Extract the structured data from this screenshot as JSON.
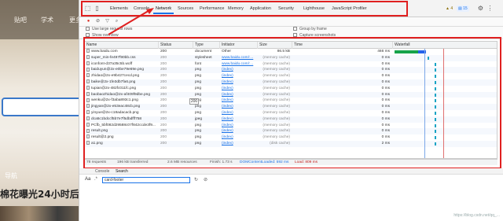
{
  "background_page": {
    "nav_items": [
      "贴吧",
      "学术",
      "更多"
    ],
    "guide_label": "导航",
    "headline": "棉花曝光24小时后"
  },
  "devtools": {
    "tabs": [
      "Elements",
      "Console",
      "Network",
      "Sources",
      "Performance",
      "Memory",
      "Application",
      "Security",
      "Lighthouse",
      "JavaScript Profiler"
    ],
    "active_tab": "Network",
    "warnings_count": "4",
    "messages_count": "15",
    "options": {
      "use_large_rows": "Use large request rows",
      "show_overview": "Show overview",
      "group_by_frame": "Group by frame",
      "capture_screenshots": "Capture screenshots"
    },
    "columns": [
      "Name",
      "Status",
      "Type",
      "Initiator",
      "Size",
      "Time",
      "Waterfall"
    ],
    "rows": [
      {
        "name": "www.baidu.com",
        "status": "200",
        "type": "document",
        "initiator": "Other",
        "size": "86.5 kB",
        "time": "466 ms",
        "wf": 0
      },
      {
        "name": "super_min-fe497f90bb.css",
        "status": "200",
        "type": "stylesheet",
        "initiator": "www.baidu.com/:...",
        "size": "(memory cache)",
        "time": "0 ms",
        "wf": 1
      },
      {
        "name": "iconfont-d37a35c5b.woff",
        "status": "200",
        "type": "font",
        "initiator": "www.baidu.com/:...",
        "size": "(memory cache)",
        "time": "0 ms",
        "wf": 2
      },
      {
        "name": "baiduyun@2x-e0be79e69e.png",
        "status": "200",
        "type": "png",
        "initiator": "(index)",
        "size": "(memory cache)",
        "time": "0 ms",
        "wf": 2
      },
      {
        "name": "zhidao@2x-e9b427cecd.png",
        "status": "200",
        "type": "png",
        "initiator": "(index)",
        "size": "(memory cache)",
        "time": "0 ms",
        "wf": 2
      },
      {
        "name": "baike@2x-1fe3db7fa6.png",
        "status": "200",
        "type": "png",
        "initiator": "(index)",
        "size": "(memory cache)",
        "time": "0 ms",
        "wf": 2
      },
      {
        "name": "tupian@2x-482fc011fc.png",
        "status": "200",
        "type": "png",
        "initiator": "(index)",
        "size": "(memory cache)",
        "time": "0 ms",
        "wf": 2
      },
      {
        "name": "baobaozhidao@2x-af409f9dbe.png",
        "status": "200",
        "type": "png",
        "initiator": "(index)",
        "size": "(memory cache)",
        "time": "0 ms",
        "wf": 2
      },
      {
        "name": "wenku@2x-f3aba893c1.png",
        "status": "200",
        "type": "png",
        "initiator": "(index)",
        "size": "(memory cache)",
        "time": "0 ms",
        "wf": 2
      },
      {
        "name": "jingyan@2x-e53eac48cb.png",
        "status": "200",
        "type": "png",
        "initiator": "(index)",
        "size": "(memory cache)",
        "time": "0 ms",
        "wf": 2
      },
      {
        "name": "yinyue@2x-c18adacacb.png",
        "status": "200",
        "type": "png",
        "initiator": "(index)",
        "size": "(memory cache)",
        "time": "0 ms",
        "wf": 2
      },
      {
        "name": "dca5c1bdccf5b7e7f5dbdfff758",
        "status": "200",
        "type": "jpeg",
        "initiator": "(index)",
        "size": "(memory cache)",
        "time": "0 ms",
        "wf": 2
      },
      {
        "name": "PCfb_5bf082d29588c07f842ccde3f9...",
        "status": "200",
        "type": "png",
        "initiator": "(index)",
        "size": "(memory cache)",
        "time": "0 ms",
        "wf": 2
      },
      {
        "name": "result.png",
        "status": "200",
        "type": "png",
        "initiator": "(index)",
        "size": "(memory cache)",
        "time": "0 ms",
        "wf": 2
      },
      {
        "name": "result@2.png",
        "status": "200",
        "type": "png",
        "initiator": "(index)",
        "size": "(memory cache)",
        "time": "0 ms",
        "wf": 2
      },
      {
        "name": "a1.png",
        "status": "200",
        "type": "png",
        "initiator": "(index)",
        "size": "(disk cache)",
        "time": "2 ms",
        "wf": 2
      }
    ],
    "tooltip": "200",
    "status": {
      "requests": "78 requests",
      "transferred": "196 kB transferred",
      "resources": "2.6 MB resources",
      "finish": "Finish: 1.73 s",
      "dcl": "DOMContentLoaded: 592 ms",
      "load": "Load: 809 ms"
    },
    "drawer_tabs": [
      "Console",
      "Search"
    ],
    "search": {
      "aa": "Aa",
      "value": "card-footer"
    }
  },
  "colors": {
    "highlight": "#e02020",
    "accent": "#1a73e8"
  },
  "watermark": "https://blog.csdn.net/qq_..."
}
